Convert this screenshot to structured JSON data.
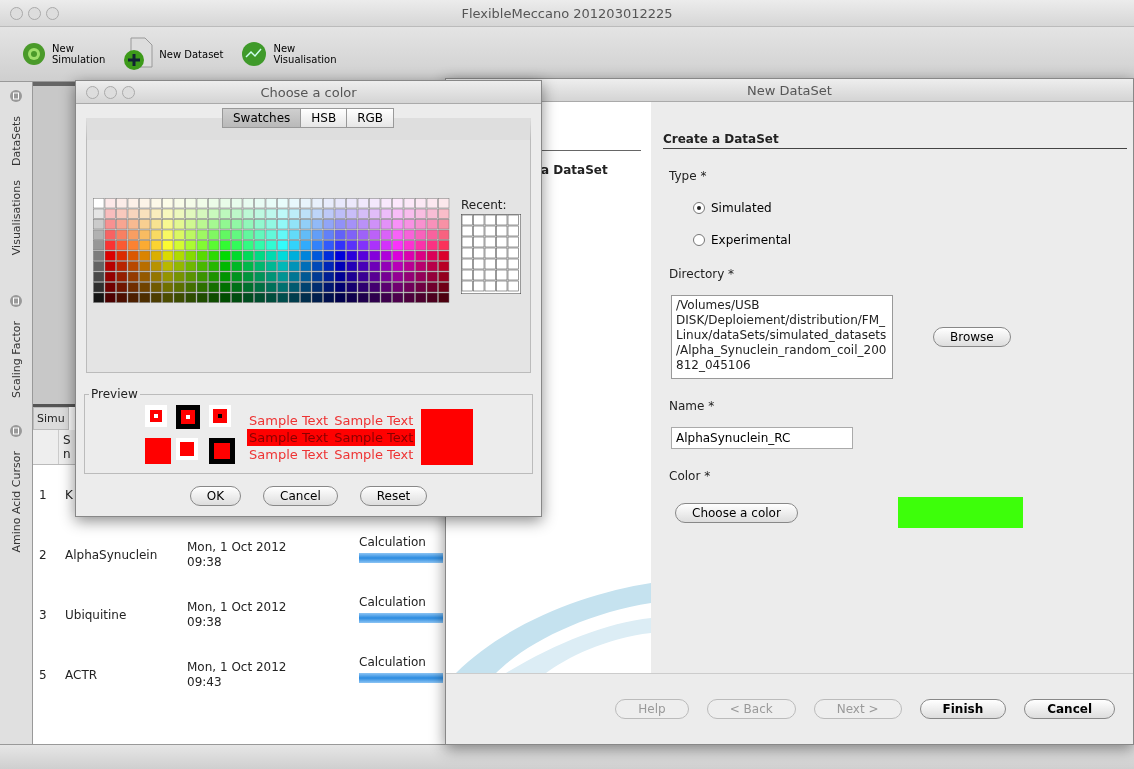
{
  "window": {
    "title": "FlexibleMeccano 201203012225"
  },
  "toolbar": [
    {
      "kind": "simulation",
      "label": "New\nSimulation"
    },
    {
      "kind": "dataset",
      "label": "New Dataset"
    },
    {
      "kind": "visualisation",
      "label": "New\nVisualisation"
    }
  ],
  "sidebar": {
    "groups": [
      {
        "items": [
          "DataSets",
          "Visualisations"
        ]
      },
      {
        "items": [
          "Scaling Factor"
        ]
      },
      {
        "items": [
          "Amino Acid Cursor"
        ]
      }
    ]
  },
  "table": {
    "tab": "Simu",
    "header": [
      "S",
      "n"
    ],
    "rows": [
      {
        "number": "1",
        "name": "K"
      },
      {
        "number": "2",
        "name": "AlphaSynuclein",
        "date": "Mon, 1 Oct 2012",
        "time": "09:38",
        "status": "Calculation",
        "level": 1
      },
      {
        "number": "3",
        "name": "Ubiquitine",
        "date": "Mon, 1 Oct 2012",
        "time": "09:38",
        "status": "Calculation",
        "level": 1
      },
      {
        "number": "5",
        "name": "ACTR",
        "date": "Mon, 1 Oct 2012",
        "time": "09:43",
        "status": "Calculation",
        "level": 1
      }
    ]
  },
  "color_dialog": {
    "title": "Choose a color",
    "tabs": [
      {
        "label": "Swatches",
        "selected": true
      },
      {
        "label": "HSB",
        "selected": false
      },
      {
        "label": "RGB",
        "selected": false
      }
    ],
    "recent_label": "Recent:",
    "preview": {
      "legend": "Preview",
      "rows": [
        {
          "kind": "plain",
          "texts": [
            "Sample Text",
            "Sample Text"
          ]
        },
        {
          "kind": "highlighted",
          "texts": [
            "Sample Text",
            "Sample Text"
          ]
        },
        {
          "kind": "plain",
          "texts": [
            "Sample Text",
            "Sample Text"
          ]
        }
      ]
    },
    "buttons": [
      "OK",
      "Cancel",
      "Reset"
    ]
  },
  "dataset_window": {
    "title": "New DataSet",
    "step": "a DataSet",
    "heading": "Create a DataSet",
    "type_label": "Type *",
    "types": [
      {
        "label": "Simulated",
        "selected": true
      },
      {
        "label": "Experimental",
        "selected": false
      }
    ],
    "directory_label": "Directory *",
    "directory": "/Volumes/USB DISK/Deploiement/distribution/FM_Linux/dataSets/simulated_datasets/Alpha_Synuclein_random_coil_200812_045106",
    "browse": "Browse",
    "name_label": "Name *",
    "name": "AlphaSynuclein_RC",
    "color_label": "Color *",
    "color_button": "Choose a color",
    "color": "#3dff0a",
    "buttons": [
      {
        "label": "Help",
        "disabled": true
      },
      {
        "label": "< Back",
        "disabled": true
      },
      {
        "label": "Next >",
        "disabled": true
      },
      {
        "label": "Finish",
        "disabled": false
      },
      {
        "label": "Cancel",
        "disabled": false
      }
    ]
  }
}
